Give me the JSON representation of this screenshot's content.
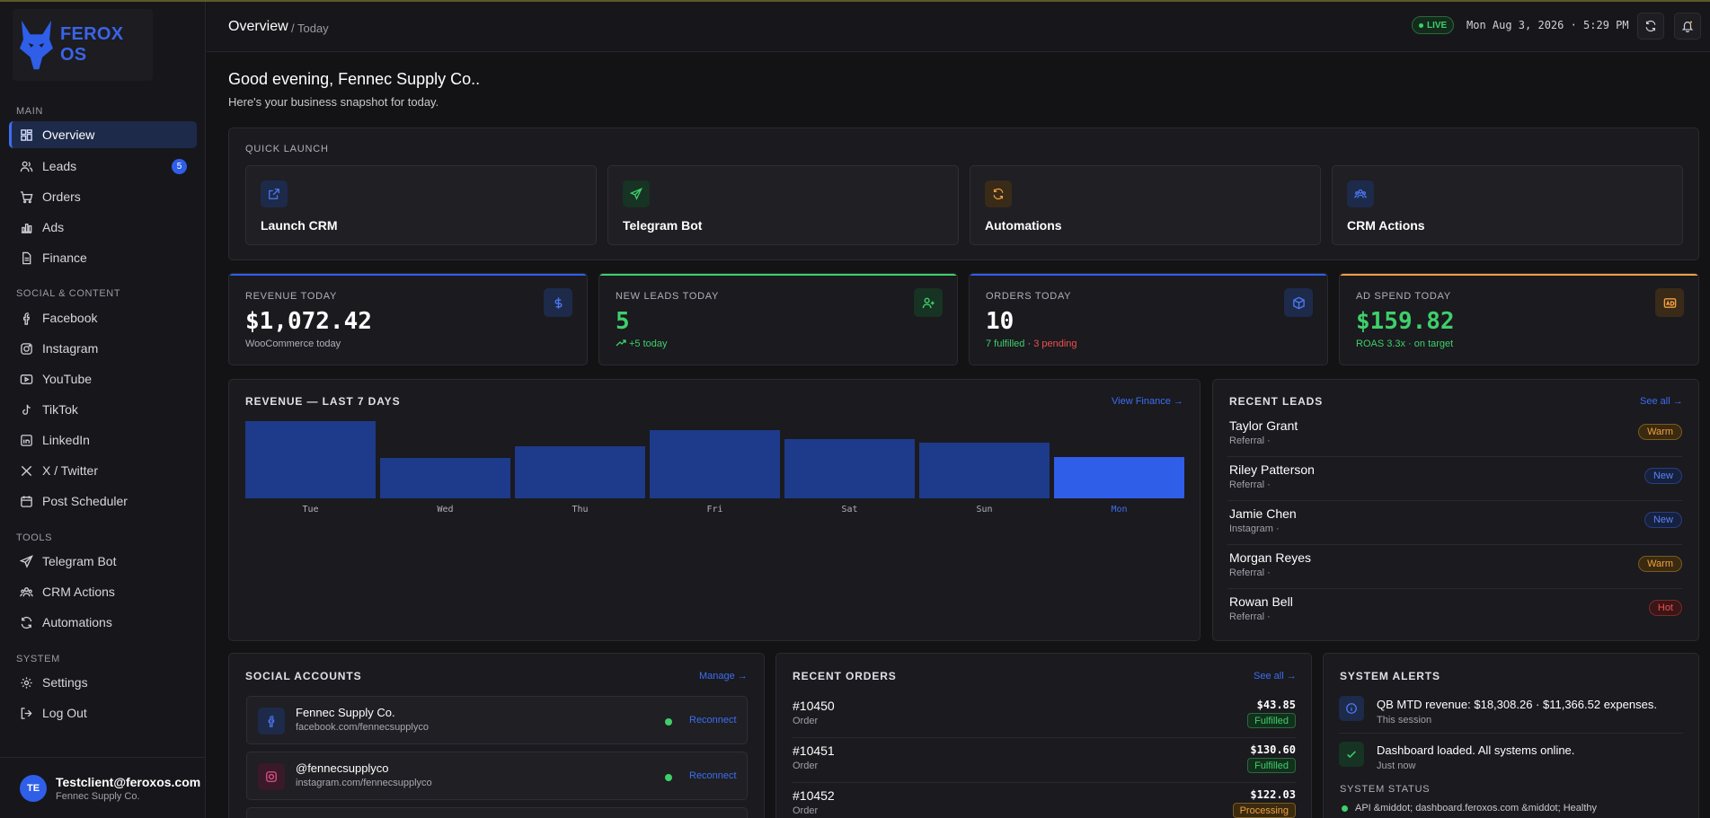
{
  "app": {
    "name": "FEROX OS"
  },
  "colors": {
    "accent": "#2f5ee8",
    "green": "#3fcf6a",
    "orange": "#f0a040",
    "red": "#f05050",
    "bg": "#131316"
  },
  "topbar": {
    "title": "Overview",
    "sub": "/ Today",
    "live": "LIVE",
    "datetime": "Mon Aug 3, 2026 · 5:29 PM"
  },
  "sidebar": {
    "sections": {
      "main": "MAIN",
      "social": "SOCIAL & CONTENT",
      "tools": "TOOLS",
      "system": "SYSTEM"
    },
    "items": [
      {
        "label": "Overview",
        "icon": "grid-icon"
      },
      {
        "label": "Leads",
        "icon": "users-icon",
        "badge": "5"
      },
      {
        "label": "Orders",
        "icon": "cart-icon"
      },
      {
        "label": "Ads",
        "icon": "bar-chart-icon"
      },
      {
        "label": "Finance",
        "icon": "document-icon"
      },
      {
        "label": "Facebook",
        "icon": "facebook-icon"
      },
      {
        "label": "Instagram",
        "icon": "instagram-icon"
      },
      {
        "label": "YouTube",
        "icon": "youtube-icon"
      },
      {
        "label": "TikTok",
        "icon": "tiktok-icon"
      },
      {
        "label": "LinkedIn",
        "icon": "linkedin-icon"
      },
      {
        "label": "X / Twitter",
        "icon": "x-icon"
      },
      {
        "label": "Post Scheduler",
        "icon": "calendar-icon"
      },
      {
        "label": "Telegram Bot",
        "icon": "send-icon"
      },
      {
        "label": "CRM Actions",
        "icon": "users-group-icon"
      },
      {
        "label": "Automations",
        "icon": "refresh-icon"
      },
      {
        "label": "Settings",
        "icon": "gear-icon"
      },
      {
        "label": "Log Out",
        "icon": "logout-icon"
      }
    ],
    "user": {
      "initials": "TE",
      "email": "Testclient@feroxos.com",
      "org": "Fennec Supply Co."
    }
  },
  "greeting": {
    "title": "Good evening, Fennec Supply Co..",
    "subtitle": "Here's your business snapshot for today."
  },
  "quick_launch": {
    "title": "QUICK LAUNCH",
    "items": [
      {
        "label": "Launch CRM",
        "icon": "external-link-icon"
      },
      {
        "label": "Telegram Bot",
        "icon": "send-icon"
      },
      {
        "label": "Automations",
        "icon": "refresh-icon"
      },
      {
        "label": "CRM Actions",
        "icon": "users-group-icon"
      }
    ]
  },
  "kpis": [
    {
      "label": "REVENUE TODAY",
      "value": "$1,072.42",
      "sub": "WooCommerce today",
      "icon": "dollar-icon"
    },
    {
      "label": "NEW LEADS TODAY",
      "value": "5",
      "sub": "+5 today",
      "icon": "user-plus-icon"
    },
    {
      "label": "ORDERS TODAY",
      "value": "10",
      "sub_a": "7 fulfilled",
      "sub_sep": " · ",
      "sub_b": "3 pending",
      "icon": "box-icon"
    },
    {
      "label": "AD SPEND TODAY",
      "value": "$159.82",
      "sub": "ROAS 3.3x · on target",
      "icon": "ad-icon"
    }
  ],
  "revenue": {
    "title": "REVENUE — LAST 7 DAYS",
    "link": "View Finance →"
  },
  "chart_data": {
    "type": "bar",
    "categories": [
      "Tue",
      "Wed",
      "Thu",
      "Fri",
      "Sat",
      "Sun",
      "Mon"
    ],
    "values": [
      1.0,
      0.52,
      0.67,
      0.88,
      0.77,
      0.72,
      0.53
    ],
    "highlight": "Mon",
    "title": "REVENUE — LAST 7 DAYS",
    "xlabel": "",
    "ylabel": ""
  },
  "recent_leads": {
    "title": "RECENT LEADS",
    "link": "See all →",
    "items": [
      {
        "name": "Taylor Grant",
        "source": "Referral ·",
        "tag": "Warm",
        "kind": "warm"
      },
      {
        "name": "Riley Patterson",
        "source": "Referral ·",
        "tag": "New",
        "kind": "new"
      },
      {
        "name": "Jamie Chen",
        "source": "Instagram ·",
        "tag": "New",
        "kind": "new"
      },
      {
        "name": "Morgan Reyes",
        "source": "Referral ·",
        "tag": "Warm",
        "kind": "warm"
      },
      {
        "name": "Rowan Bell",
        "source": "Referral ·",
        "tag": "Hot",
        "kind": "hot"
      }
    ]
  },
  "social_accounts": {
    "title": "SOCIAL ACCOUNTS",
    "link": "Manage →",
    "items": [
      {
        "name": "Fennec Supply Co.",
        "url": "facebook.com/fennecsupplyco",
        "action": "Reconnect",
        "icon": "facebook-icon"
      },
      {
        "name": "@fennecsupplyco",
        "url": "instagram.com/fennecsupplyco",
        "action": "Reconnect",
        "icon": "instagram-icon"
      }
    ]
  },
  "recent_orders": {
    "title": "RECENT ORDERS",
    "link": "See all →",
    "items": [
      {
        "id": "#10450",
        "type": "Order",
        "amount": "$43.85",
        "status": "Fulfilled",
        "kind": "ful"
      },
      {
        "id": "#10451",
        "type": "Order",
        "amount": "$130.60",
        "status": "Fulfilled",
        "kind": "ful"
      },
      {
        "id": "#10452",
        "type": "Order",
        "amount": "$122.03",
        "status": "Processing",
        "kind": "proc"
      }
    ]
  },
  "system_alerts": {
    "title": "SYSTEM ALERTS",
    "items": [
      {
        "text": "QB MTD revenue: $18,308.26 · $11,366.52 expenses.",
        "time": "This session",
        "icon": "info-icon"
      },
      {
        "text": "Dashboard loaded. All systems online.",
        "time": "Just now",
        "icon": "check-icon"
      }
    ],
    "status_title": "SYSTEM STATUS",
    "status_line": "API &middot; dashboard.feroxos.com &middot; Healthy"
  }
}
